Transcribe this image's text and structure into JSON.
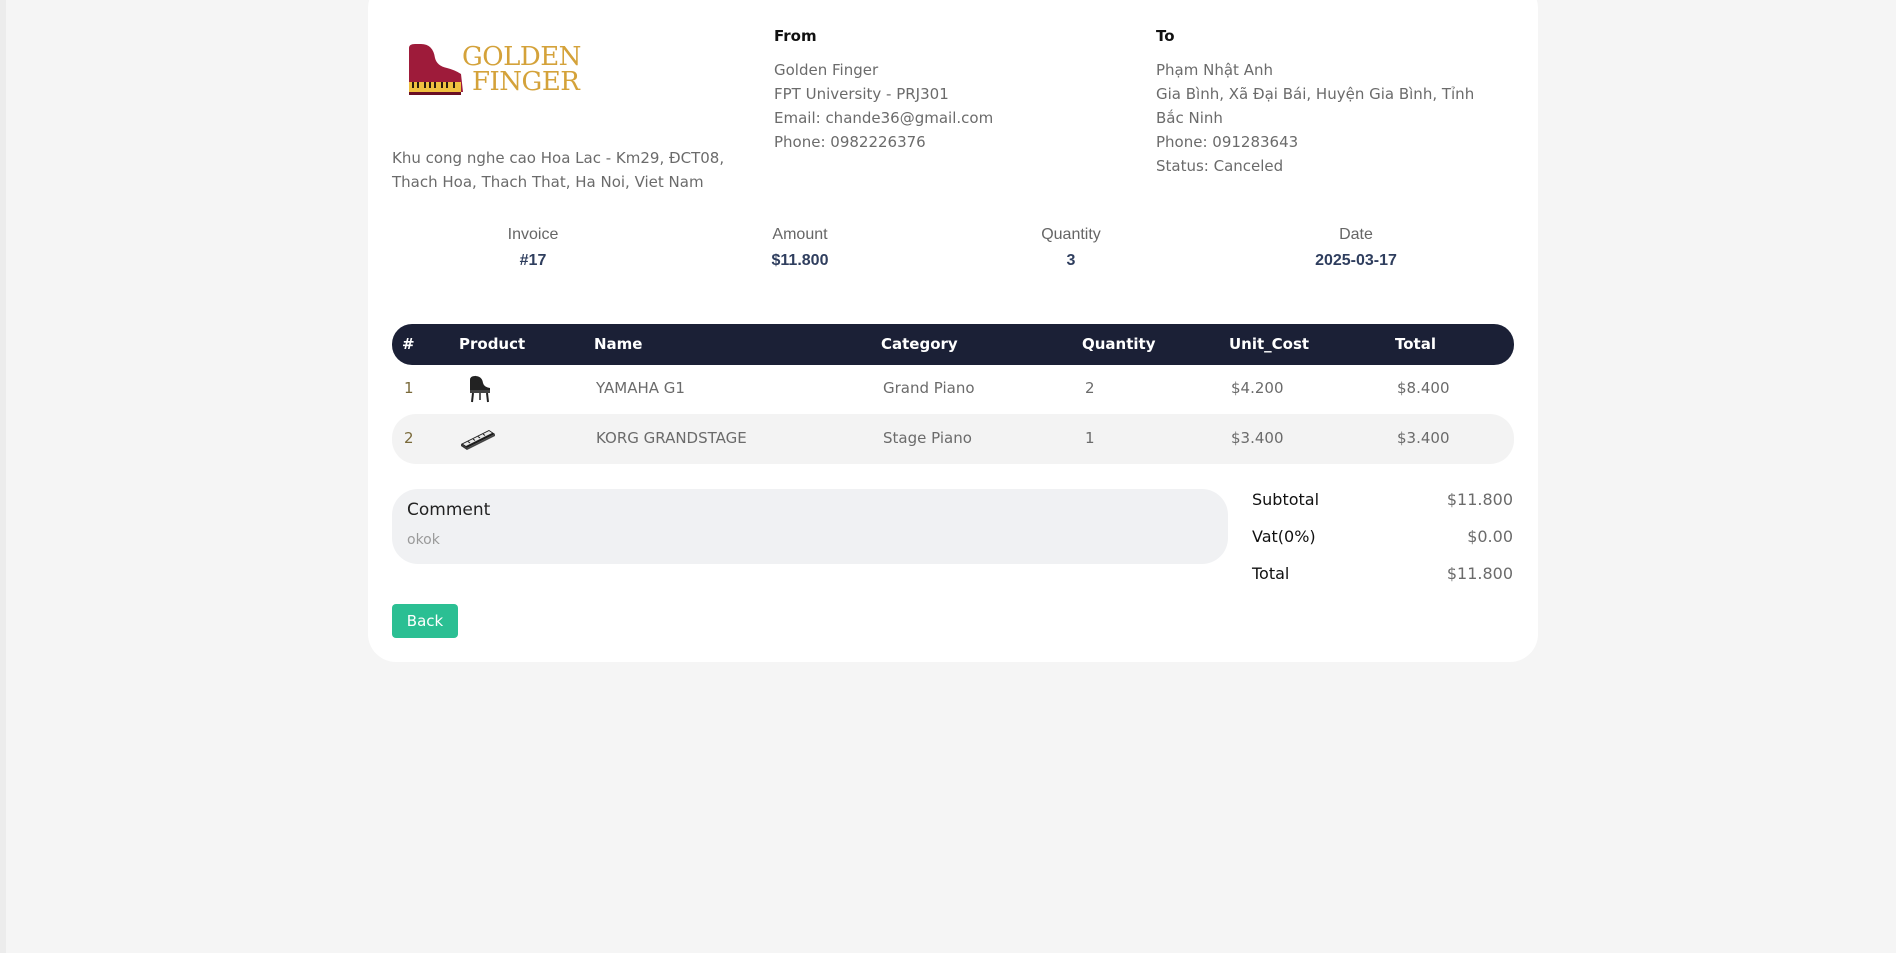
{
  "brand": {
    "logo_line1": "GOLDEN",
    "logo_line2": "FINGER",
    "address": "Khu cong nghe cao Hoa Lac - Km29, ĐCT08, Thach Hoa, Thach That, Ha Noi, Viet Nam",
    "logo_colors": {
      "piano": "#9e1b3a",
      "text": "#d4a23a"
    }
  },
  "from": {
    "heading": "From",
    "name": "Golden Finger",
    "org": "FPT University - PRJ301",
    "email": "Email: chande36@gmail.com",
    "phone": "Phone: 0982226376"
  },
  "to": {
    "heading": "To",
    "name": "Phạm Nhật Anh",
    "address": "Gia Bình, Xã Đại Bái, Huyện Gia Bình, Tỉnh Bắc Ninh",
    "phone": "Phone: 091283643",
    "status": "Status: Canceled"
  },
  "summary": {
    "invoice_label": "Invoice",
    "invoice_value": "#17",
    "amount_label": "Amount",
    "amount_value": "$11.800",
    "quantity_label": "Quantity",
    "quantity_value": "3",
    "date_label": "Date",
    "date_value": "2025-03-17"
  },
  "table": {
    "headers": [
      "#",
      "Product",
      "Name",
      "Category",
      "Quantity",
      "Unit_Cost",
      "Total"
    ],
    "rows": [
      {
        "no": "1",
        "product_icon": "grand-piano-icon",
        "name": "YAMAHA G1",
        "category": "Grand Piano",
        "quantity": "2",
        "unit_cost": "$4.200",
        "total": "$8.400"
      },
      {
        "no": "2",
        "product_icon": "stage-piano-icon",
        "name": "KORG GRANDSTAGE",
        "category": "Stage Piano",
        "quantity": "1",
        "unit_cost": "$3.400",
        "total": "$3.400"
      }
    ]
  },
  "comment": {
    "title": "Comment",
    "text": "okok"
  },
  "totals": {
    "subtotal_label": "Subtotal",
    "subtotal_value": "$11.800",
    "vat_label": "Vat(0%)",
    "vat_value": "$0.00",
    "total_label": "Total",
    "total_value": "$11.800"
  },
  "actions": {
    "back_label": "Back"
  },
  "colors": {
    "header_bg": "#1b2036",
    "back_button": "#2bbf93",
    "page_bg": "#f5f5f5"
  }
}
